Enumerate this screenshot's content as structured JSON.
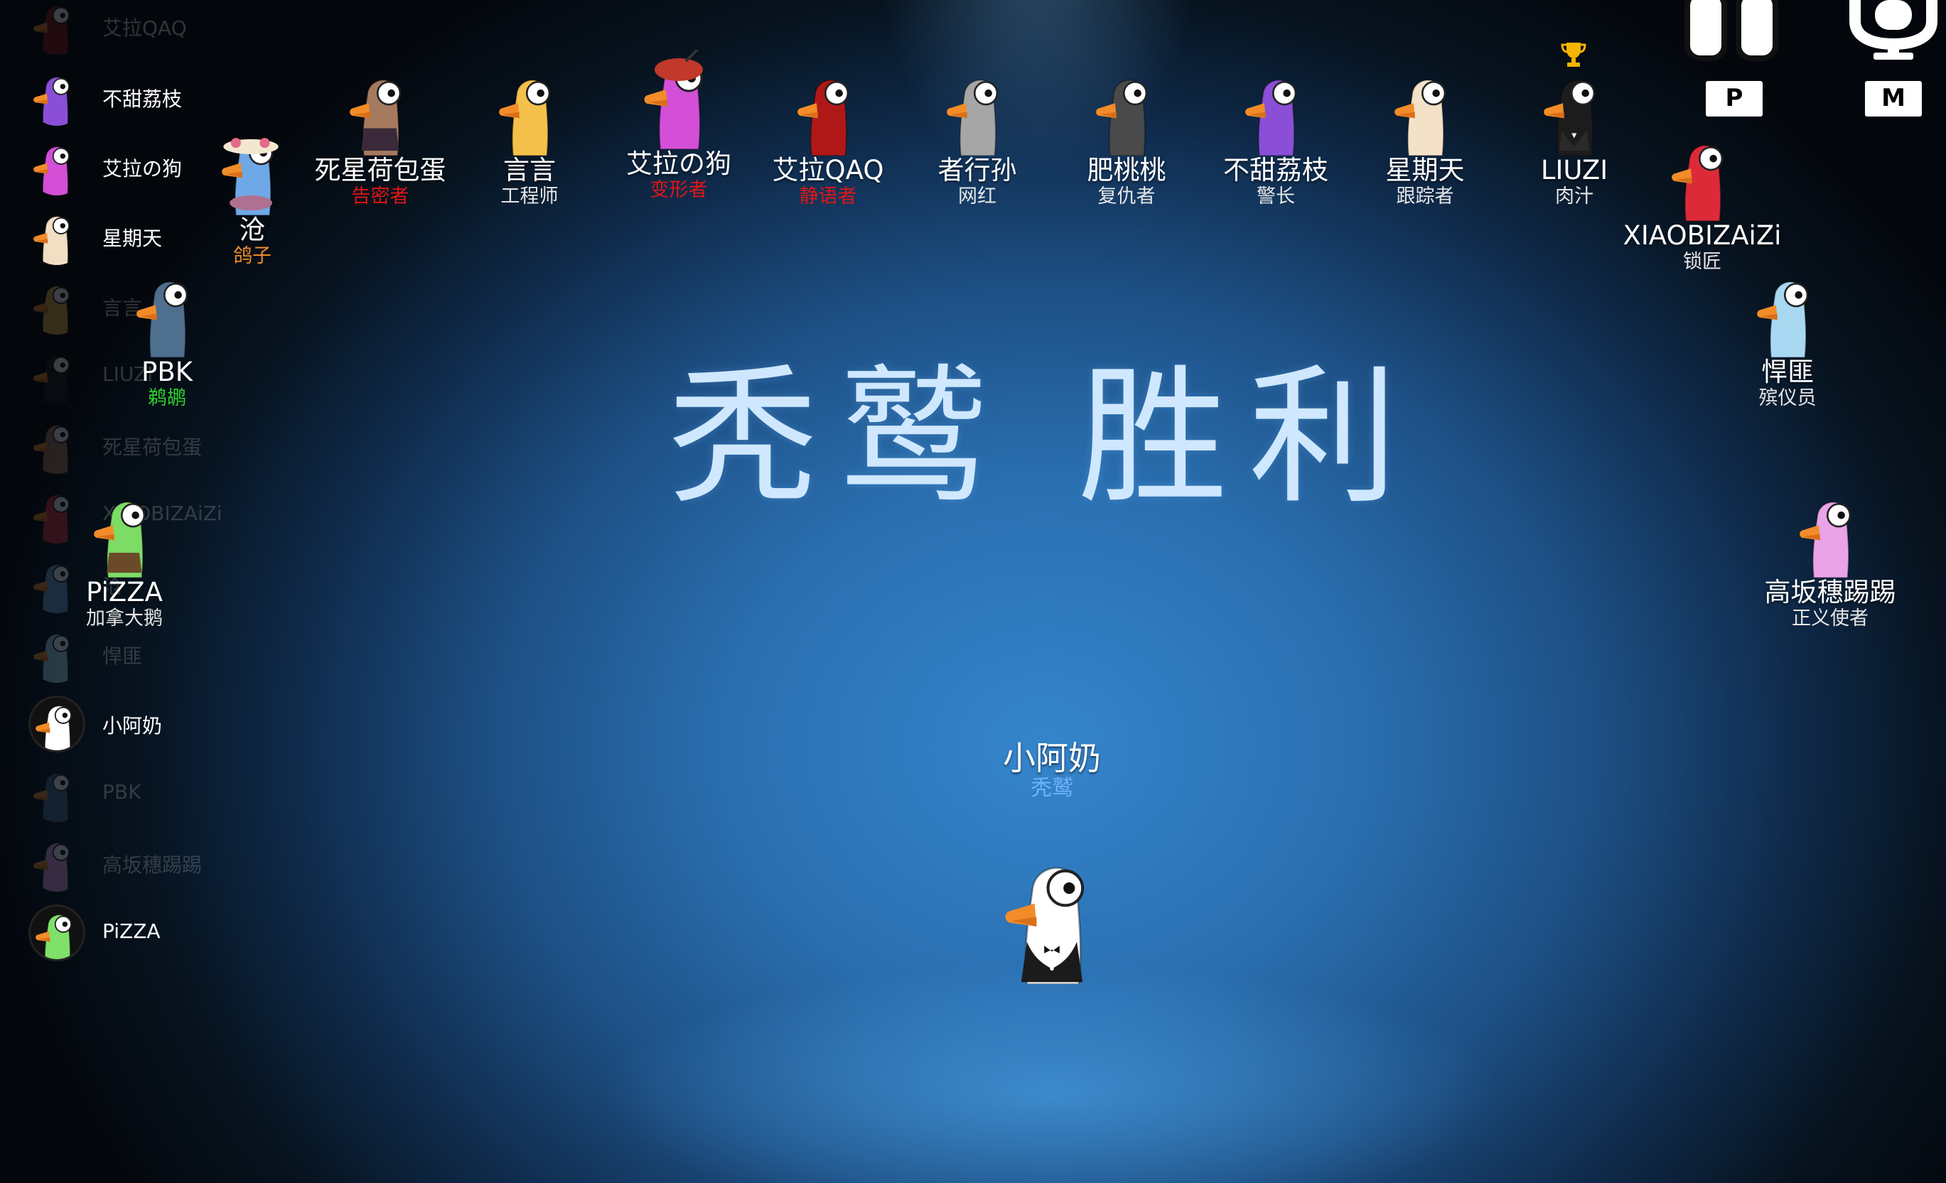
{
  "sidebar": [
    {
      "name": "艾拉QAQ",
      "color": "#8a1a1a",
      "state": "dead"
    },
    {
      "name": "不甜荔枝",
      "color": "#8a4fd6",
      "state": "alive"
    },
    {
      "name": "艾拉の狗",
      "color": "#d34fd6",
      "state": "alive"
    },
    {
      "name": "星期天",
      "color": "#f1dec3",
      "state": "alive"
    },
    {
      "name": "言言",
      "color": "#e6b34a",
      "state": "dead"
    },
    {
      "name": "LIUZI",
      "color": "#1a1a1a",
      "state": "dead"
    },
    {
      "name": "死星荷包蛋",
      "color": "#a67a5f",
      "state": "dead"
    },
    {
      "name": "XIAOBIZAiZi",
      "color": "#d9303d",
      "state": "dead"
    },
    {
      "name": "沧",
      "color": "#6fa0d6",
      "state": "dead"
    },
    {
      "name": "悍匪",
      "color": "#a8d8f0",
      "state": "dead"
    },
    {
      "name": "小阿奶",
      "color": "#ffffff",
      "state": "me"
    },
    {
      "name": "PBK",
      "color": "#4a6a8a",
      "state": "dead"
    },
    {
      "name": "高坂穗踢踢",
      "color": "#e49be0",
      "state": "dead"
    },
    {
      "name": "PiZZA",
      "color": "#7fe06a",
      "state": "me"
    }
  ],
  "players": [
    {
      "name": "死星荷包蛋",
      "role": "告密者",
      "role_color": "red",
      "color": "#a67a5f",
      "accessory": "armor"
    },
    {
      "name": "言言",
      "role": "工程师",
      "role_color": "white",
      "color": "#f5c04a",
      "accessory": "none"
    },
    {
      "name": "艾拉の狗",
      "role": "变形者",
      "role_color": "red",
      "color": "#d44fd8",
      "accessory": "hat"
    },
    {
      "name": "艾拉QAQ",
      "role": "静语者",
      "role_color": "red",
      "color": "#b01818",
      "accessory": "none"
    },
    {
      "name": "者行孙",
      "role": "网红",
      "role_color": "white",
      "color": "#a6a6a6",
      "accessory": "none"
    },
    {
      "name": "肥桃桃",
      "role": "复仇者",
      "role_color": "white",
      "color": "#4a4a4a",
      "accessory": "none"
    },
    {
      "name": "不甜荔枝",
      "role": "警长",
      "role_color": "white",
      "color": "#8a4fd6",
      "accessory": "none"
    },
    {
      "name": "星期天",
      "role": "跟踪者",
      "role_color": "white",
      "color": "#f3e2c8",
      "accessory": "none"
    },
    {
      "name": "LIUZI",
      "role": "肉汁",
      "role_color": "white",
      "color": "#1c1c1c",
      "accessory": "suit"
    },
    {
      "name": "沧",
      "role": "鸽子",
      "role_color": "orange",
      "color": "#6fa8e6",
      "accessory": "flower-hat"
    },
    {
      "name": "XIAOBIZAiZi",
      "role": "锁匠",
      "role_color": "white",
      "color": "#dd2a38",
      "accessory": "none"
    },
    {
      "name": "PBK",
      "role": "鹈鹕",
      "role_color": "green",
      "color": "#4f6f8f",
      "accessory": "none"
    },
    {
      "name": "悍匪",
      "role": "殡仪员",
      "role_color": "white",
      "color": "#a8d8f2",
      "accessory": "none"
    },
    {
      "name": "PiZZA",
      "role": "加拿大鹅",
      "role_color": "white",
      "color": "#7ddc66",
      "accessory": "backpack"
    },
    {
      "name": "高坂穗踢踢",
      "role": "正义使者",
      "role_color": "white",
      "color": "#e9a3e6",
      "accessory": "none"
    }
  ],
  "winner": {
    "title": "秃鹫 胜利",
    "name": "小阿奶",
    "role": "秃鹫",
    "color": "#ffffff",
    "outfit": "tuxedo"
  },
  "hud": {
    "key_p": "P",
    "key_m": "M",
    "icon_p": "controller-icon",
    "icon_m": "microphone-icon"
  },
  "colors": {
    "impostor_role": "#e01616",
    "neutral_role": "#f08a2a",
    "pelican_role": "#2ed12e",
    "title": "#cfe8ff"
  }
}
